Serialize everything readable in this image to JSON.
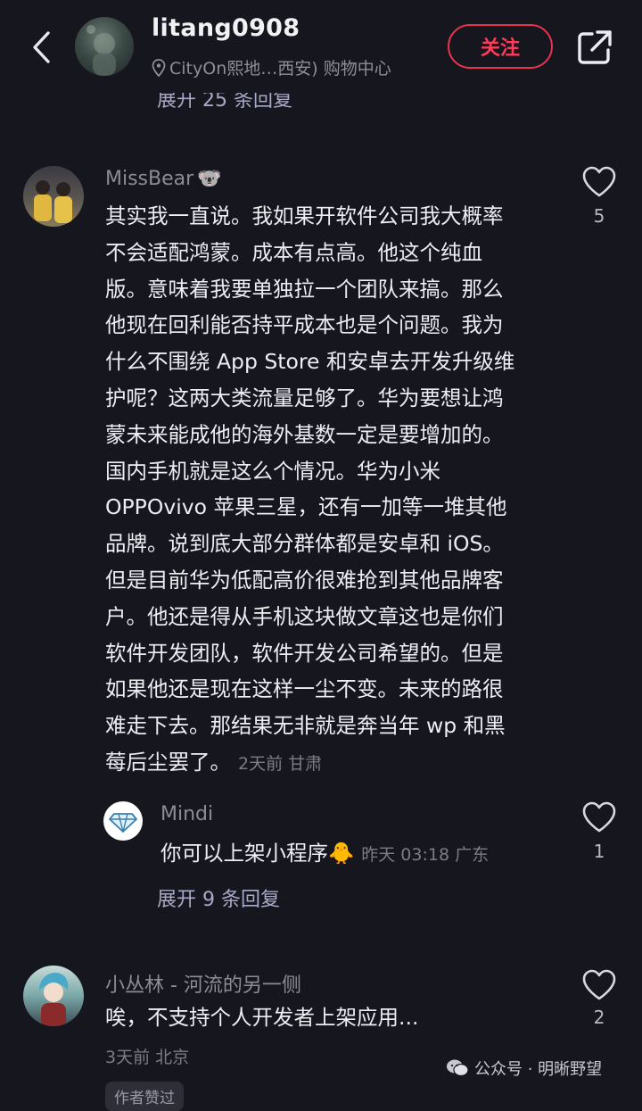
{
  "header": {
    "username": "litang0908",
    "location": "CityOn熙地…西安) 购物中心",
    "follow_label": "关注",
    "partial_expand": "展开 25 条回复"
  },
  "comments": [
    {
      "user": "MissBear",
      "user_emoji": "🐨",
      "lines": [
        "其实我一直说。我如果开软件公司我大概率",
        "不会适配鸿蒙。成本有点高。他这个纯血",
        "版。意味着我要单独拉一个团队来搞。那么",
        "他现在回利能否持平成本也是个问题。我为",
        "什么不围绕 App Store 和安卓去开发升级维",
        "护呢？这两大类流量足够了。华为要想让鸿",
        "蒙未来能成他的海外基数一定是要增加的。",
        "国内手机就是这么个情况。华为小米",
        "OPPOvivo 苹果三星，还有一加等一堆其他",
        "品牌。说到底大部分群体都是安卓和 iOS。",
        "但是目前华为低配高价很难抢到其他品牌客",
        "户。他还是得从手机这块做文章这也是你们",
        "软件开发团队，软件开发公司希望的。但是",
        "如果他还是现在这样一尘不变。未来的路很",
        "难走下去。那结果无非就是奔当年 wp 和黑"
      ],
      "last_line": "莓后尘罢了。",
      "meta": "2天前 甘肃",
      "likes": "5"
    },
    {
      "user": "Mindi",
      "text": "你可以上架小程序",
      "text_emoji": "🐥",
      "meta": "昨天 03:18 广东",
      "likes": "1",
      "expand": "展开 9 条回复"
    },
    {
      "user": "小丛林 - 河流的另一侧",
      "text": "唉，不支持个人开发者上架应用...",
      "meta": "3天前 北京",
      "likes": "2",
      "tag": "作者赞过"
    }
  ],
  "watermark": "公众号 · 明晰野望"
}
